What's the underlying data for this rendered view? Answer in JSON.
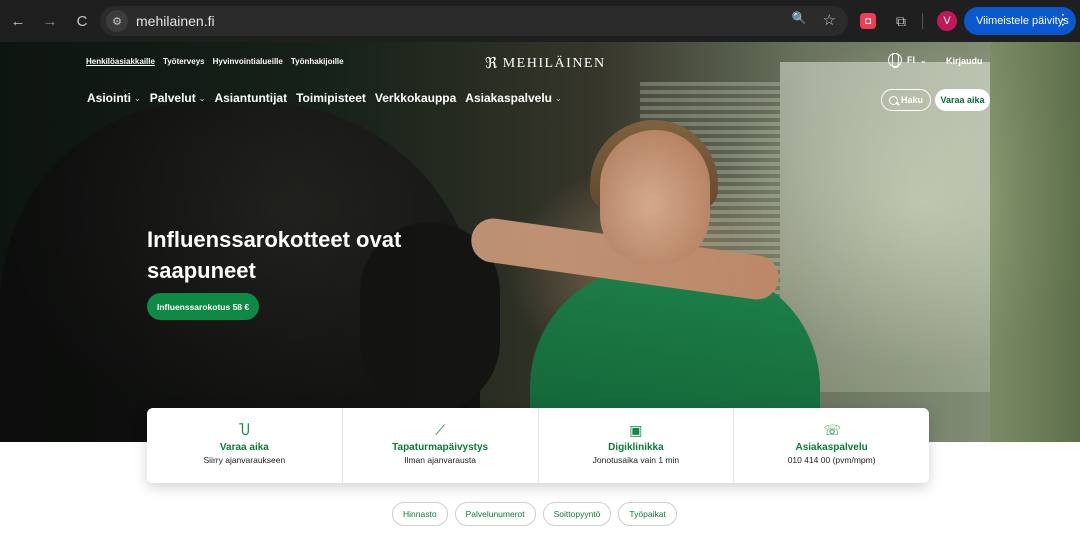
{
  "browser": {
    "back_icon": "←",
    "forward_icon": "→",
    "reload_icon": "C",
    "site_settings_icon": "⚙",
    "url": "mehilainen.fi",
    "zoom_icon": "🔍",
    "star_icon": "☆",
    "pocket_icon": "◘",
    "puzzle_icon": "⧉",
    "profile_initial": "V",
    "update_label": "Viimeistele päivitys",
    "menu_icon": "⋮",
    "colors": {
      "toolbar": "#1f1f1f",
      "update_button": "#0b57d0",
      "profile": "#c2185b"
    }
  },
  "header": {
    "util_nav": [
      "Henkilöasiakkaille",
      "Työterveys",
      "Hyvinvointialueille",
      "Työnhakijoille"
    ],
    "brand_icon": "ℜ",
    "brand_name": "MEHILÄINEN",
    "language": "FI",
    "login": "Kirjaudu",
    "main_nav": [
      {
        "label": "Asiointi",
        "has_dropdown": true
      },
      {
        "label": "Palvelut",
        "has_dropdown": true
      },
      {
        "label": "Asiantuntijat",
        "has_dropdown": false
      },
      {
        "label": "Toimipisteet",
        "has_dropdown": false
      },
      {
        "label": "Verkkokauppa",
        "has_dropdown": false
      },
      {
        "label": "Asiakaspalvelu",
        "has_dropdown": true
      }
    ],
    "search_label": "Haku",
    "book_label": "Varaa aika",
    "chevron": "⌄"
  },
  "hero": {
    "title": "Influenssarokotteet ovat saapuneet",
    "cta": "Influenssarokotus 58 €"
  },
  "cards": [
    {
      "icon": "Ⴎ",
      "title": "Varaa aika",
      "subtitle": "Siirry ajanvaraukseen"
    },
    {
      "icon": "⟋",
      "title": "Tapaturmapäivystys",
      "subtitle": "Ilman ajanvarausta"
    },
    {
      "icon": "▣",
      "title": "Digiklinikka",
      "subtitle": "Jonotusaika vain 1 min"
    },
    {
      "icon": "☏",
      "title": "Asiakaspalvelu",
      "subtitle": "010 414 00 (pvm/mpm)"
    }
  ],
  "quick_links": [
    "Hinnasto",
    "Palvelunumerot",
    "Soittopyyntö",
    "Työpaikat"
  ],
  "colors": {
    "brand_green": "#0e8a45",
    "text_green": "#0b7a3d"
  }
}
